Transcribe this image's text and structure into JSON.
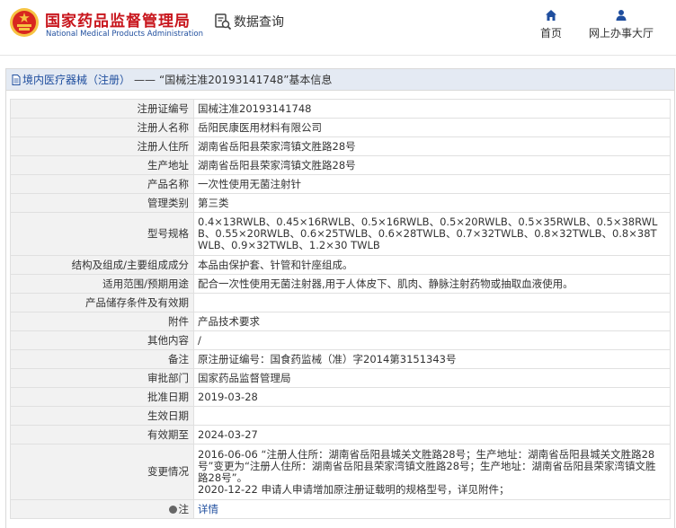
{
  "header": {
    "brand_cn": "国家药品监督管理局",
    "brand_en": "National Medical Products Administration",
    "search_label": "数据查询",
    "nav": {
      "home": "首页",
      "online_hall": "网上办事大厅"
    }
  },
  "breadcrumb": {
    "section": "境内医疗器械（注册）",
    "separator": "——",
    "title": "“国械注准20193141748”基本信息"
  },
  "rows": [
    {
      "key": "注册证编号",
      "value": "国械注准20193141748"
    },
    {
      "key": "注册人名称",
      "value": "岳阳民康医用材料有限公司"
    },
    {
      "key": "注册人住所",
      "value": "湖南省岳阳县荣家湾镇文胜路28号"
    },
    {
      "key": "生产地址",
      "value": "湖南省岳阳县荣家湾镇文胜路28号"
    },
    {
      "key": "产品名称",
      "value": "一次性使用无菌注射针"
    },
    {
      "key": "管理类别",
      "value": "第三类"
    },
    {
      "key": "型号规格",
      "value": "0.4×13RWLB、0.45×16RWLB、0.5×16RWLB、0.5×20RWLB、0.5×35RWLB、0.5×38RWLB、0.55×20RWLB、0.6×25TWLB、0.6×28TWLB、0.7×32TWLB、0.8×32TWLB、0.8×38TWLB、0.9×32TWLB、1.2×30 TWLB"
    },
    {
      "key": "结构及组成/主要组成成分",
      "value": "本品由保护套、针管和针座组成。"
    },
    {
      "key": "适用范围/预期用途",
      "value": "配合一次性使用无菌注射器,用于人体皮下、肌肉、静脉注射药物或抽取血液使用。"
    },
    {
      "key": "产品储存条件及有效期",
      "value": ""
    },
    {
      "key": "附件",
      "value": "产品技术要求"
    },
    {
      "key": "其他内容",
      "value": "/"
    },
    {
      "key": "备注",
      "value": "原注册证编号：国食药监械（准）字2014第3151343号"
    },
    {
      "key": "审批部门",
      "value": "国家药品监督管理局"
    },
    {
      "key": "批准日期",
      "value": "2019-03-28"
    },
    {
      "key": "生效日期",
      "value": ""
    },
    {
      "key": "有效期至",
      "value": "2024-03-27"
    },
    {
      "key": "变更情况",
      "value_lines": [
        "2016-06-06 “注册人住所：湖南省岳阳县城关文胜路28号；生产地址：湖南省岳阳县城关文胜路28号”变更为“注册人住所：湖南省岳阳县荣家湾镇文胜路28号；生产地址：湖南省岳阳县荣家湾镇文胜路28号”。",
        "2020-12-22 申请人申请增加原注册证载明的规格型号，详见附件；"
      ]
    },
    {
      "key": "注",
      "value": "详情"
    }
  ],
  "colors": {
    "brand_red": "#c8161d",
    "brand_blue": "#1f4e9e",
    "title_bar": "#e4eaf3",
    "key_cell": "#f2f2f2"
  },
  "icons": {
    "emblem": "national-emblem-icon",
    "search": "data-search-icon",
    "home": "home-icon",
    "hall": "user-icon",
    "doc": "document-icon",
    "note": "info-dot-icon"
  }
}
